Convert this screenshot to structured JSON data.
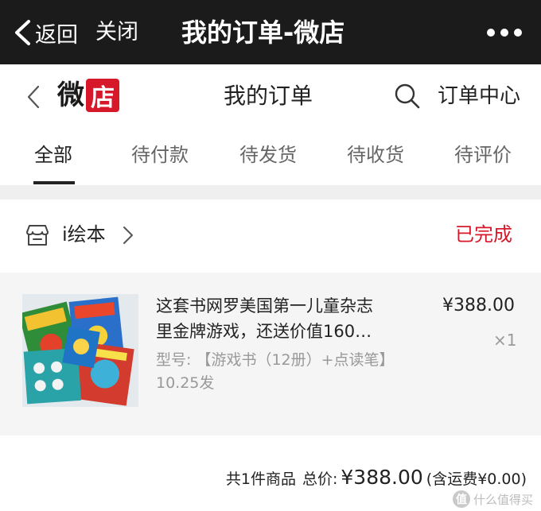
{
  "topbar": {
    "back_label": "返回",
    "close_label": "关闭",
    "title": "我的订单-微店"
  },
  "shop_header": {
    "logo_text_1": "微",
    "logo_text_2": "店",
    "title": "我的订单",
    "order_center": "订单中心"
  },
  "tabs": [
    {
      "label": "全部",
      "active": true
    },
    {
      "label": "待付款"
    },
    {
      "label": "待发货"
    },
    {
      "label": "待收货"
    },
    {
      "label": "待评价"
    }
  ],
  "order": {
    "shop_name": "i绘本",
    "status": "已完成",
    "product": {
      "name_line1": "这套书网罗美国第一儿童杂志",
      "name_line2": "里金牌游戏，还送价值160…",
      "model": "型号: 【游戏书（12册）+点读笔】10.25发",
      "price": "¥388.00",
      "quantity": "×1"
    },
    "summary": {
      "count": "共1件商品",
      "total_label": "总价:",
      "total_price": "¥388.00",
      "shipping": "(含运费¥0.00)"
    }
  },
  "watermark": {
    "logo": "值",
    "text": "什么值得买"
  },
  "colors": {
    "topbar_bg": "#1b1b1b",
    "accent_red": "#d7182a",
    "gray_bg": "#efefef"
  },
  "icons": {
    "back": "chevron-left-icon",
    "more": "more-dots-icon",
    "search": "search-icon",
    "store": "store-icon",
    "shop_chevron": "chevron-right-icon"
  }
}
